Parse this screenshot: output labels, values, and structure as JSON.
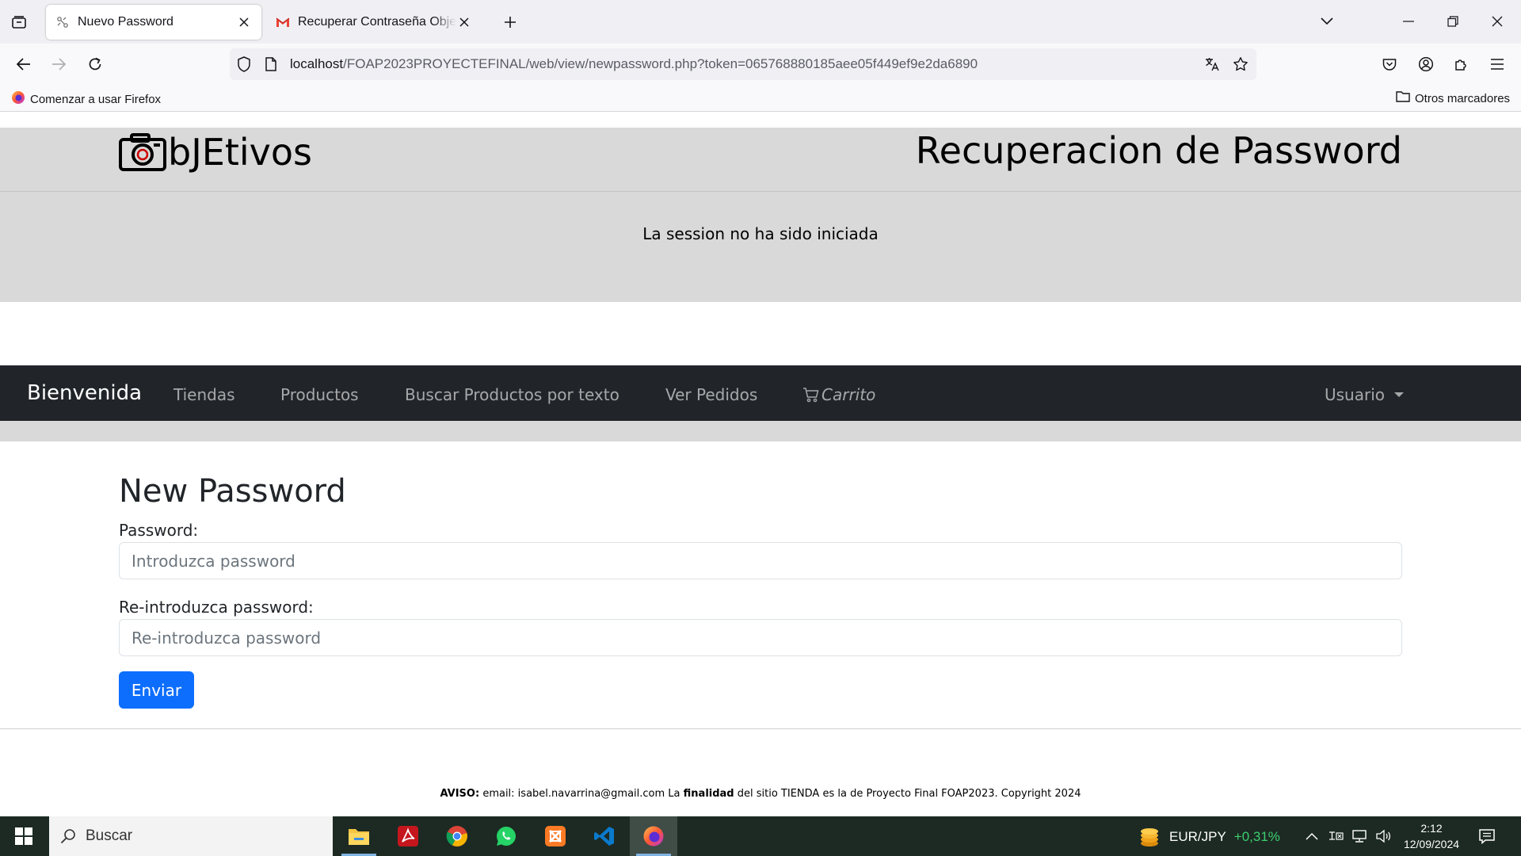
{
  "browser": {
    "tabs": [
      {
        "title": "Nuevo Password",
        "active": true
      },
      {
        "title": "Recuperar Contraseña Objetivos",
        "active": false
      }
    ],
    "url": {
      "host": "localhost",
      "path": "/FOAP2023PROYECTEFINAL/web/view/newpassword.php?token=065768880185aee05f449ef9e2da6890"
    },
    "bookmarks": {
      "getting_started": "Comenzar a usar Firefox",
      "other": "Otros marcadores"
    }
  },
  "site": {
    "logo_text": "bJEtivos",
    "page_heading": "Recuperacion de Password",
    "session_status": "La session no ha sido iniciada"
  },
  "nav": {
    "brand": "Bienvenida",
    "links": [
      "Tiendas",
      "Productos",
      "Buscar Productos por texto",
      "Ver Pedidos"
    ],
    "cart": "Carrito",
    "user_menu": "Usuario"
  },
  "form": {
    "title": "New Password",
    "password_label": "Password:",
    "password_placeholder": "Introduzca password",
    "repeat_label": "Re-introduzca password:",
    "repeat_placeholder": "Re-introduzca password",
    "submit": "Enviar"
  },
  "footer": {
    "aviso": "AVISO:",
    "text1": " email: isabel.navarrina@gmail.com La ",
    "finalidad": "finalidad",
    "text2": " del sitio TIENDA es la de Proyecto Final FOAP2023. Copyright 2024"
  },
  "taskbar": {
    "search_placeholder": "Buscar",
    "ticker_symbol": "EUR/JPY",
    "ticker_change": "+0,31%",
    "time": "2:12",
    "date": "12/09/2024"
  },
  "colors": {
    "nav_bg": "#212529",
    "header_bg": "#d9d9d9",
    "primary": "#0d6efd",
    "taskbar_bg": "#1c2a23"
  }
}
